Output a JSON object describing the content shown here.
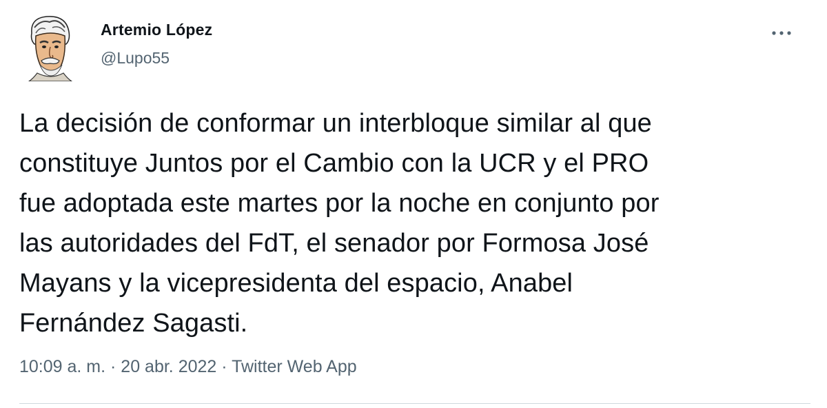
{
  "author": {
    "name": "Artemio López",
    "handle": "@Lupo55"
  },
  "tweet": {
    "text": "La decisión de conformar un interbloque similar al que\nconstituye Juntos por el Cambio con la UCR y el PRO\nfue adoptada este martes por la noche en conjunto por\nlas autoridades del FdT, el senador por Formosa José\nMayans y la vicepresidenta del espacio, Anabel\nFernández Sagasti."
  },
  "meta": {
    "time": "10:09 a. m.",
    "separator": " · ",
    "date": "20 abr. 2022",
    "source": "Twitter Web App"
  },
  "icons": {
    "more": "more-horizontal-icon",
    "avatar": "avatar-caricature"
  },
  "colors": {
    "text_primary": "#0f1419",
    "text_secondary": "#536471",
    "divider": "#cfd9de"
  }
}
